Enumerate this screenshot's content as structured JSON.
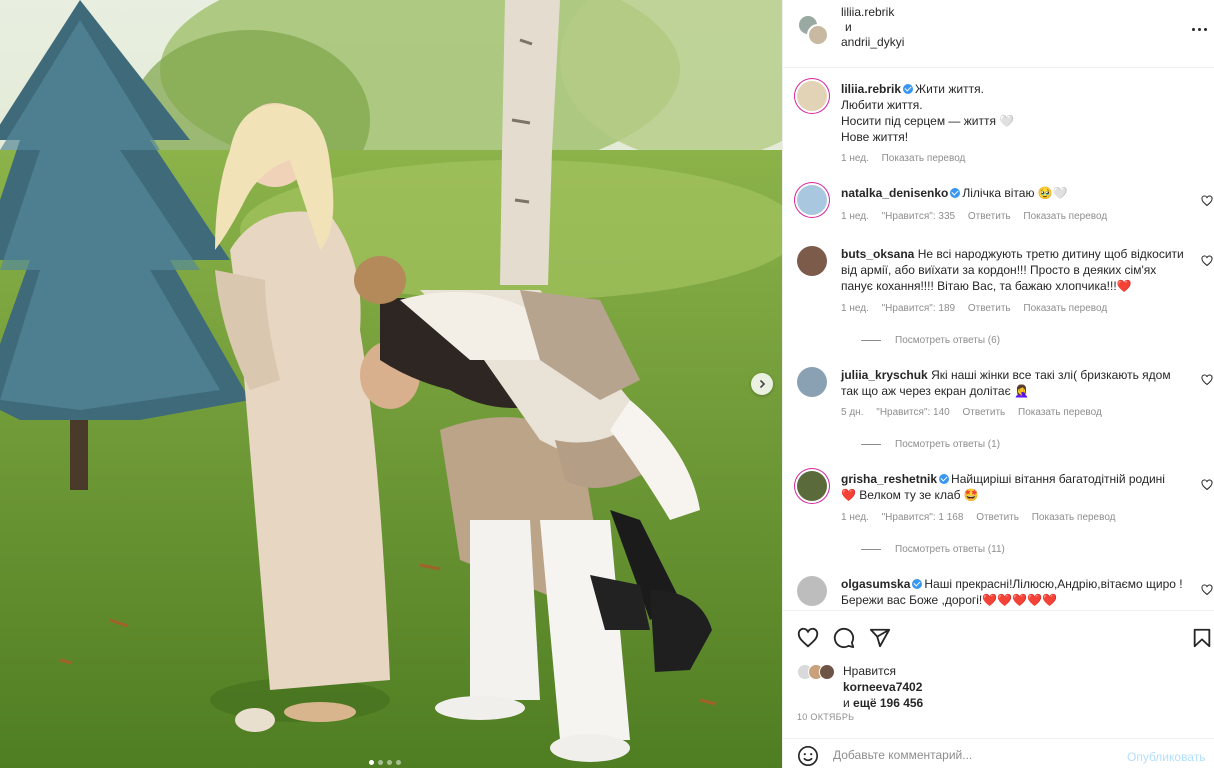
{
  "header": {
    "user1": "liliia.rebrik",
    "conj": "и",
    "user2": "andrii_dykyi"
  },
  "caption": {
    "user": "liliia.rebrik",
    "line1": "Жити життя.",
    "line2": "Любити життя.",
    "line3": "Носити під серцем — життя 🤍",
    "line4": "Нове життя!",
    "time": "1 нед.",
    "translate": "Показать перевод"
  },
  "comments": [
    {
      "user": "natalka_denisenko",
      "text": "Лілічка вітаю 🥹🤍",
      "time": "1 нед.",
      "likes": "\"Нравится\": 335",
      "reply": "Ответить",
      "translate": "Показать перевод"
    },
    {
      "user": "buts_oksana",
      "text": "Не всі народжують третю дитину щоб відкосити від армії, або виїхати за кордон!!! Просто в деяких сім'ях панує кохання!!!! Вітаю Вас, та бажаю хлопчика!!!",
      "heart": "❤️",
      "time": "1 нед.",
      "likes": "\"Нравится\": 189",
      "reply": "Ответить",
      "translate": "Показать перевод",
      "view_replies": "Посмотреть ответы (6)"
    },
    {
      "user": "juliia_kryschuk",
      "text": "Які наші жінки все такі злі( бризкають ядом так що аж через екран долітає 🤦‍♀️",
      "time": "5 дн.",
      "likes": "\"Нравится\": 140",
      "reply": "Ответить",
      "translate": "Показать перевод",
      "view_replies": "Посмотреть ответы (1)"
    },
    {
      "user": "grisha_reshetnik",
      "text": "Найщиріші вітання багатодітній родині",
      "text2": "Велком ту зе клаб 🤩",
      "heart": "❤️",
      "time": "1 нед.",
      "likes": "\"Нравится\": 1 168",
      "reply": "Ответить",
      "translate": "Показать перевод",
      "view_replies": "Посмотреть ответы (11)"
    },
    {
      "user": "olgasumska",
      "text": "Наші прекрасні!Лілюсю,Андрію,вітаємо щиро !Бережи вас Боже ,дорогі!",
      "hearts": "❤️❤️❤️❤️❤️"
    }
  ],
  "likes": {
    "label": "Нравится",
    "user": "korneeva7402",
    "more_prefix": "и",
    "more_count": "ещё 196 456"
  },
  "date": "10 ОКТЯБРЬ",
  "add_comment": {
    "placeholder": "Добавьте комментарий...",
    "publish": "Опубликовать"
  },
  "colors": {
    "link": "#3897f0",
    "heart": "#ed4956",
    "muted": "#8e8e8e",
    "publish_disabled": "#b2dffc"
  },
  "icons": [
    "heart-icon",
    "comment-icon",
    "share-icon",
    "bookmark-icon",
    "emoji-icon",
    "more-icon",
    "chevron-right-icon"
  ]
}
